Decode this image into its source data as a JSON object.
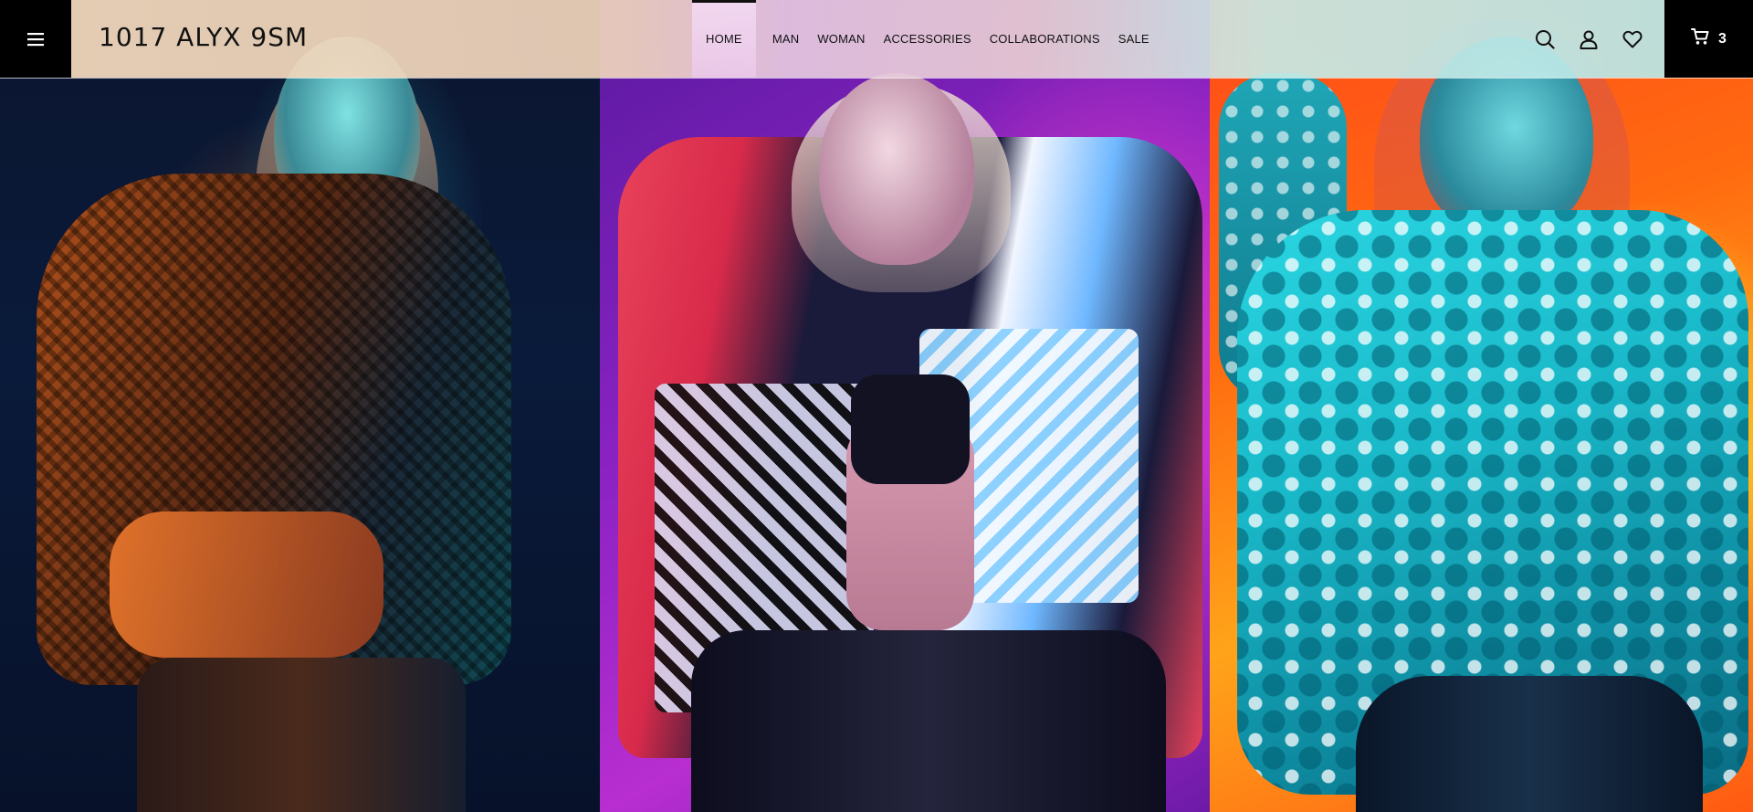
{
  "brand": {
    "logo_text": "1017 ALYX 9SM"
  },
  "header": {
    "menu_icon": "hamburger-menu-icon",
    "nav": [
      {
        "label": "HOME",
        "active": true
      },
      {
        "label": "MAN",
        "active": false
      },
      {
        "label": "WOMAN",
        "active": false
      },
      {
        "label": "ACCESSORIES",
        "active": false
      },
      {
        "label": "COLLABORATIONS",
        "active": false
      },
      {
        "label": "SALE",
        "active": false
      }
    ],
    "icons": [
      "search-icon",
      "user-icon",
      "heart-icon"
    ],
    "cart": {
      "icon": "cart-icon",
      "count": "3"
    }
  },
  "hero": {
    "panels": [
      {
        "name": "hero-panel-woven-jacket",
        "accent": "#0a1a3a"
      },
      {
        "name": "hero-panel-patterned-jacket",
        "accent": "#9a24c8"
      },
      {
        "name": "hero-panel-sequin-jacket",
        "accent": "#ff7a10"
      }
    ]
  },
  "colors": {
    "header_black": "#000000",
    "text": "#111111"
  }
}
